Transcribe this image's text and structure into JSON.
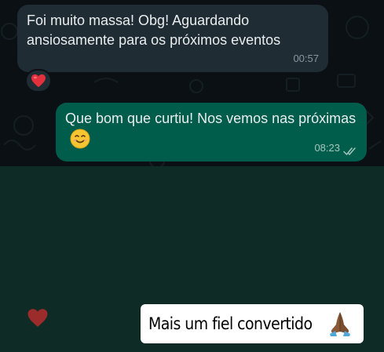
{
  "messages": {
    "incoming": {
      "text": "Foi muito massa! Obg! Aguardando ansiosamente para os próximos eventos",
      "time": "00:57",
      "reaction_icon": "heart-icon"
    },
    "outgoing": {
      "text": "Que bom que curtiu! Nos vemos nas próximas",
      "emoji_icon": "smiling-face-icon",
      "time": "08:23",
      "status_icon": "double-check-icon"
    }
  },
  "story_overlay": {
    "caption": "Mais um fiel convertido",
    "caption_emoji_icon": "folded-hands-icon",
    "like_icon": "heart-icon"
  },
  "colors": {
    "chat_background": "#0b1014",
    "incoming_bubble": "#1f2c34",
    "outgoing_bubble": "#005c4b",
    "overlay_background": "#0f2b26",
    "heart": "#9c2b2b",
    "caption_background": "#ffffff"
  }
}
